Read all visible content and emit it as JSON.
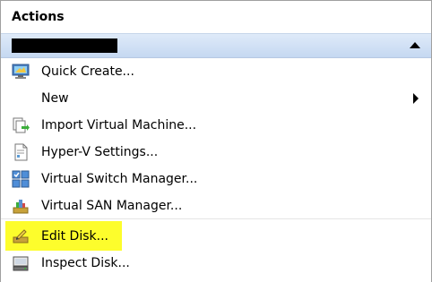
{
  "pane": {
    "title": "Actions"
  },
  "group": {
    "name": "",
    "redacted": true,
    "collapse_icon": "collapse-up-arrow"
  },
  "menu": {
    "items": [
      {
        "label": "Quick Create...",
        "icon": "quick-create-icon",
        "has_submenu": false
      },
      {
        "label": "New",
        "icon": "",
        "has_submenu": true
      },
      {
        "label": "Import Virtual Machine...",
        "icon": "import-vm-icon",
        "has_submenu": false
      },
      {
        "label": "Hyper-V Settings...",
        "icon": "settings-document-icon",
        "has_submenu": false
      },
      {
        "label": "Virtual Switch Manager...",
        "icon": "switch-manager-icon",
        "has_submenu": false
      },
      {
        "label": "Virtual SAN Manager...",
        "icon": "san-manager-icon",
        "has_submenu": false
      },
      {
        "label": "Edit Disk...",
        "icon": "edit-disk-icon",
        "has_submenu": false,
        "highlighted": true
      },
      {
        "label": "Inspect Disk...",
        "icon": "inspect-disk-icon",
        "has_submenu": false
      }
    ]
  },
  "colors": {
    "highlight": "#fdfd2c",
    "group_bar": "#c5d8f1"
  }
}
